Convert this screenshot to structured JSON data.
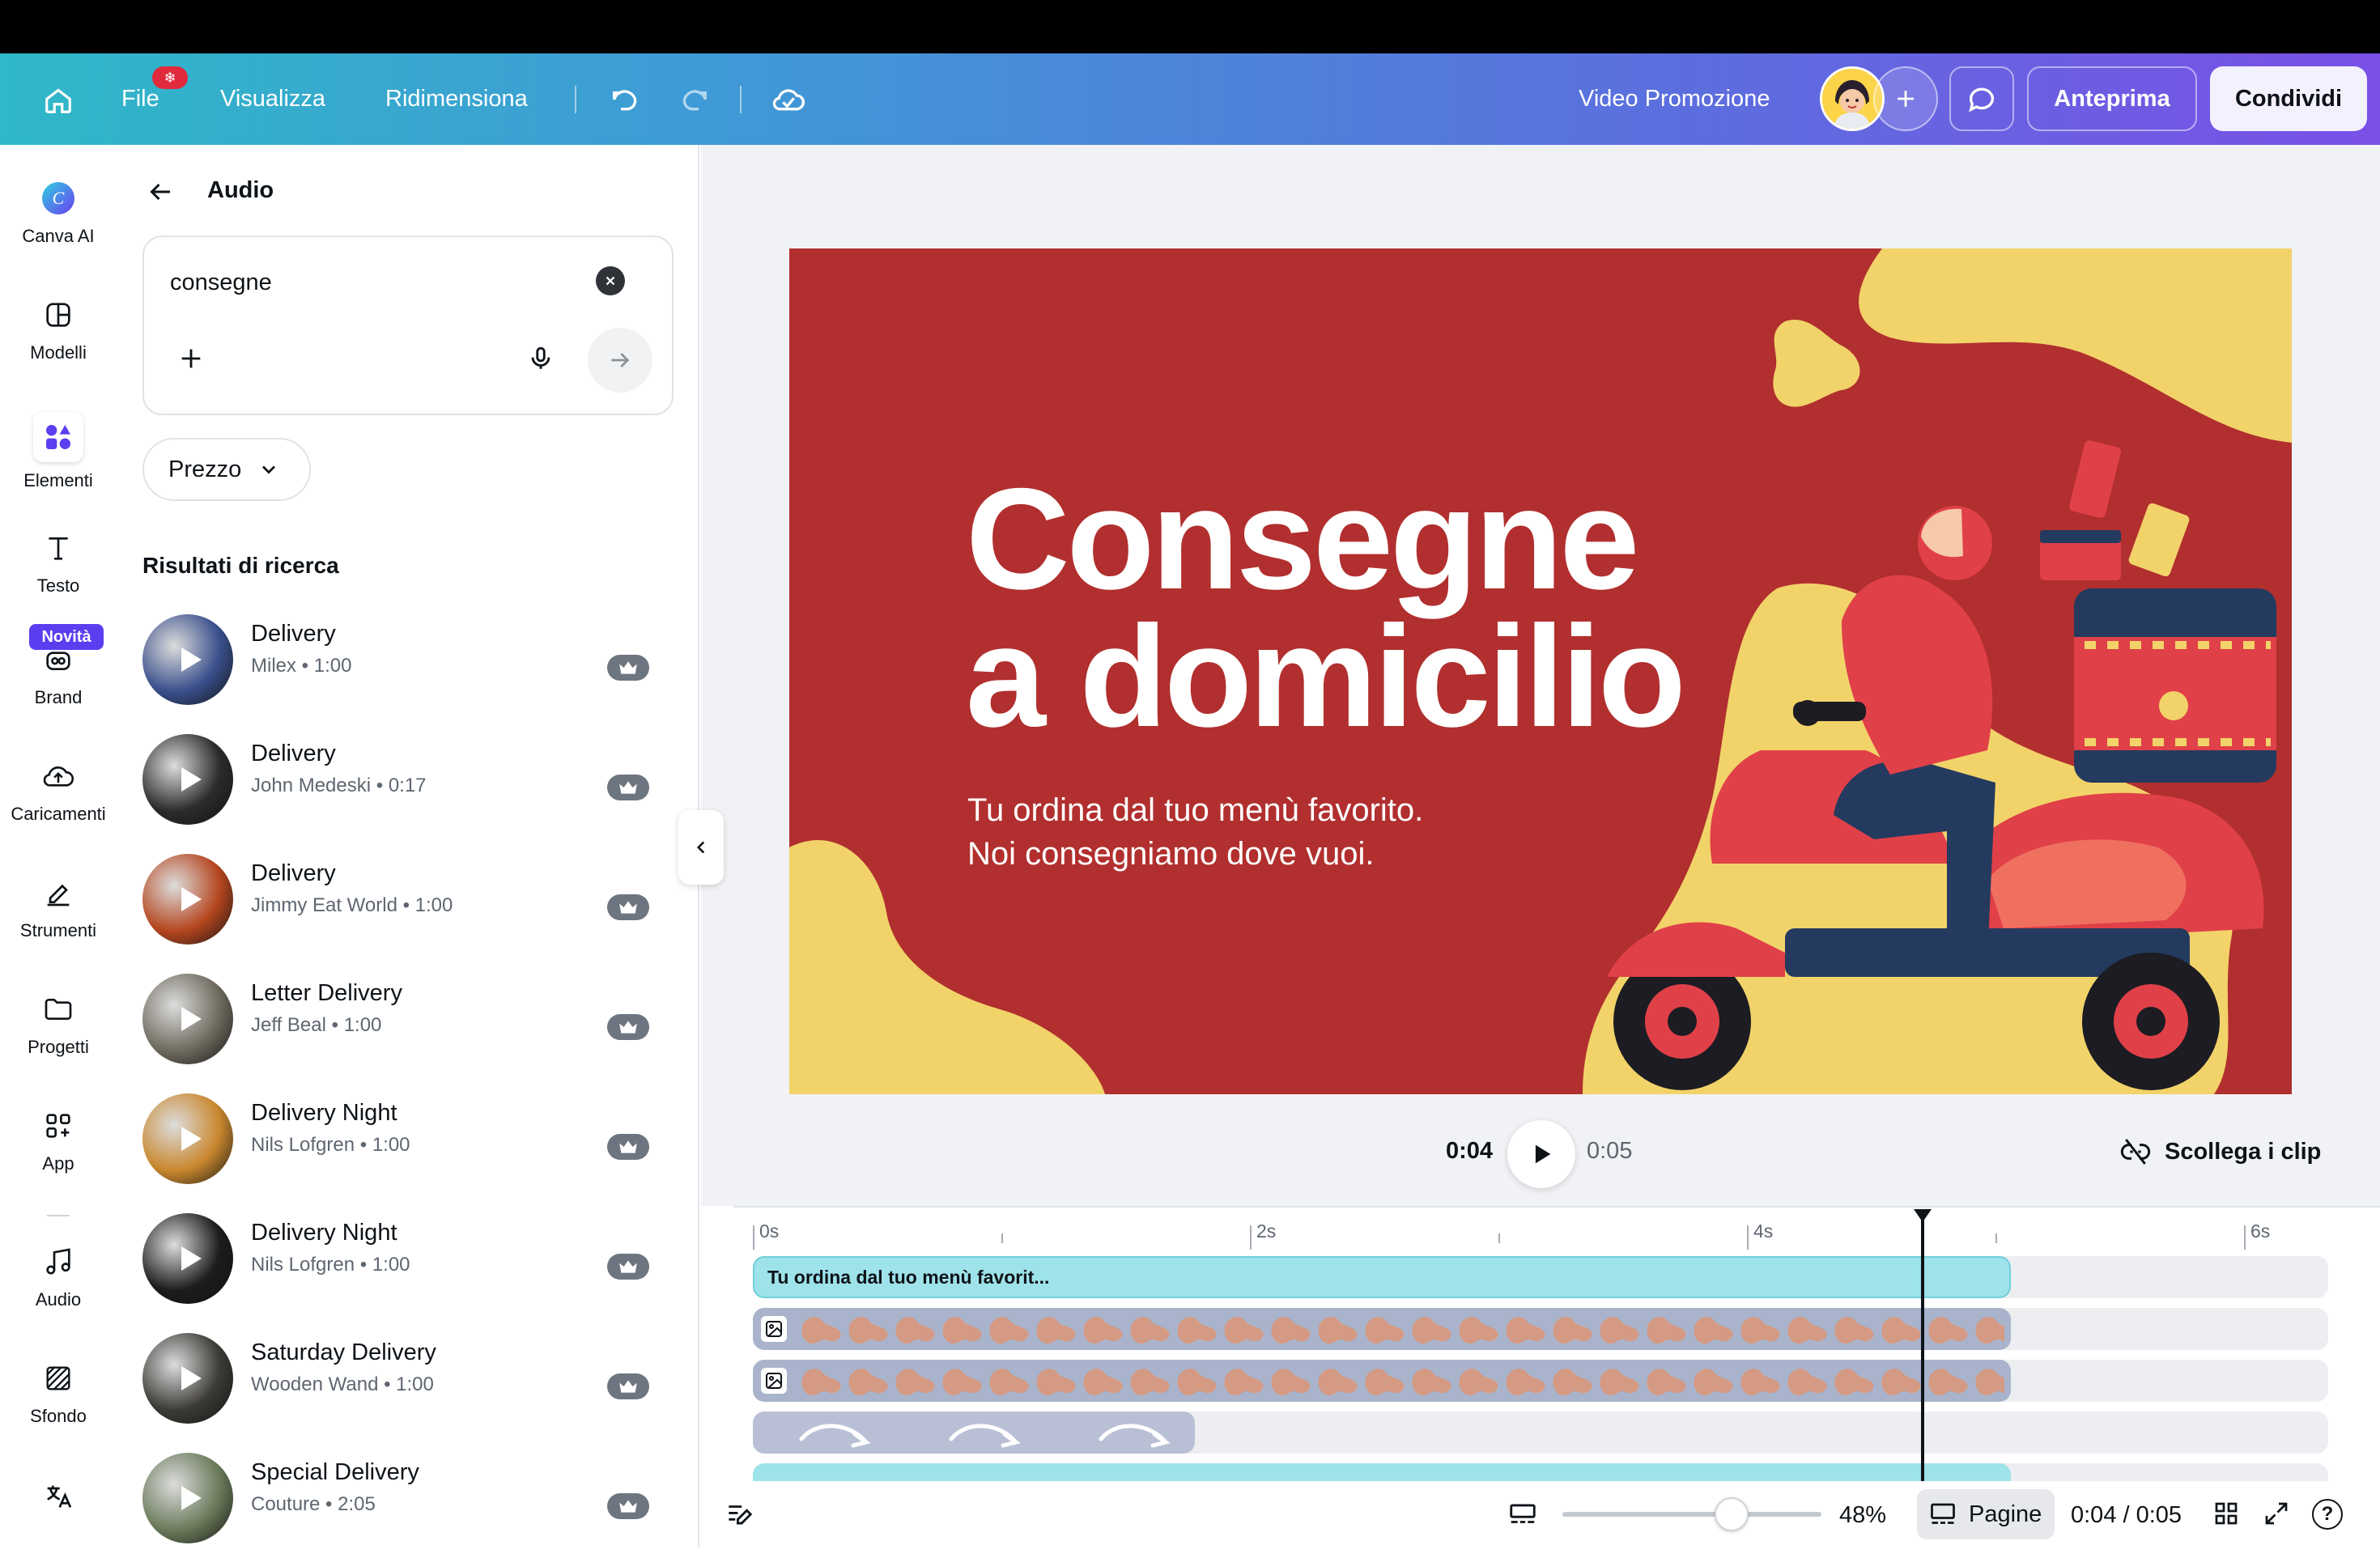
{
  "header": {
    "home_icon": "home-icon",
    "file_label": "File",
    "file_badge": "❄",
    "view_label": "Visualizza",
    "resize_label": "Ridimensiona",
    "project_title": "Video Promozione",
    "preview_label": "Anteprima",
    "share_label": "Condividi",
    "accent_color": "#7a50e6"
  },
  "rail": {
    "items": [
      {
        "label": "Canva AI",
        "icon": "canva-ai-icon"
      },
      {
        "label": "Modelli",
        "icon": "templates-icon"
      },
      {
        "label": "Elementi",
        "icon": "elements-icon"
      },
      {
        "label": "Testo",
        "icon": "text-icon"
      },
      {
        "label": "Brand",
        "icon": "brand-icon",
        "badge": "Novità"
      },
      {
        "label": "Caricamenti",
        "icon": "upload-icon"
      },
      {
        "label": "Strumenti",
        "icon": "tools-icon"
      },
      {
        "label": "Progetti",
        "icon": "folder-icon"
      },
      {
        "label": "App",
        "icon": "apps-icon"
      },
      {
        "label": "Audio",
        "icon": "music-icon"
      },
      {
        "label": "Sfondo",
        "icon": "background-icon"
      }
    ]
  },
  "panel": {
    "title": "Audio",
    "search_value": "consegne",
    "price_filter": "Prezzo",
    "results_heading": "Risultati di ricerca",
    "results": [
      {
        "title": "Delivery",
        "meta": "Milex • 1:00",
        "color": "#3a4f8c"
      },
      {
        "title": "Delivery",
        "meta": "John Medeski • 0:17",
        "color": "#2b2b2b"
      },
      {
        "title": "Delivery",
        "meta": "Jimmy Eat World • 1:00",
        "color": "#b5461f"
      },
      {
        "title": "Letter Delivery",
        "meta": "Jeff Beal • 1:00",
        "color": "#6f6a5e"
      },
      {
        "title": "Delivery Night",
        "meta": "Nils Lofgren • 1:00",
        "color": "#c9872e"
      },
      {
        "title": "Delivery Night",
        "meta": "Nils Lofgren • 1:00",
        "color": "#1c1c1c"
      },
      {
        "title": "Saturday Delivery",
        "meta": "Wooden Wand • 1:00",
        "color": "#3c3a36"
      },
      {
        "title": "Special Delivery",
        "meta": "Couture • 2:05",
        "color": "#6a7a5a"
      }
    ]
  },
  "canvas": {
    "headline_line1": "Consegne",
    "headline_line2": "a domicilio",
    "sub_line1": "Tu ordina dal tuo menù favorito.",
    "sub_line2": "Noi consegniamo dove vuoi.",
    "bg_color": "#b12f2e",
    "shape_color": "#f2d36a"
  },
  "player": {
    "current_time": "0:04",
    "total_time": "0:05",
    "unlink_label": "Scollega i clip"
  },
  "timeline": {
    "ticks": [
      "0s",
      "2s",
      "4s",
      "6s"
    ],
    "text_clip_label": "Tu ordina dal tuo menù favorit...",
    "playhead_seconds": 5.0
  },
  "bottombar": {
    "zoom_label": "48%",
    "zoom_value": 0.48,
    "pages_label": "Pagine",
    "time_label": "0:04 / 0:05",
    "help_label": "?"
  }
}
